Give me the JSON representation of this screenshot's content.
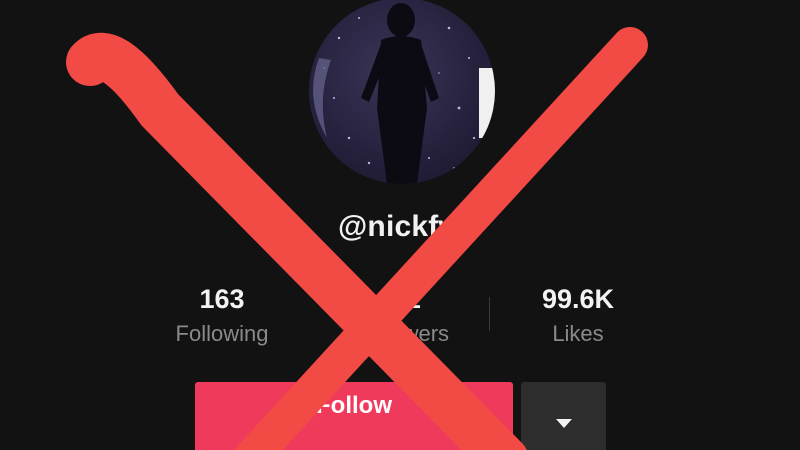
{
  "profile": {
    "username": "@nickfw",
    "avatar_description": "silhouette-figure-night-sky"
  },
  "stats": {
    "following": {
      "value": "163",
      "label": "Following"
    },
    "followers": {
      "value": "5.1",
      "label": "Followers"
    },
    "likes": {
      "value": "99.6K",
      "label": "Likes"
    }
  },
  "actions": {
    "follow_label": "Follow",
    "dropdown_icon": "caret-down-icon"
  },
  "colors": {
    "background": "#121212",
    "follow_button": "#f03a5c",
    "dropdown_button": "#2d2d2d",
    "cross_mark": "#f24a45",
    "label_gray": "#8a8a8a"
  },
  "annotation": {
    "mark": "red-x-cross-out"
  }
}
